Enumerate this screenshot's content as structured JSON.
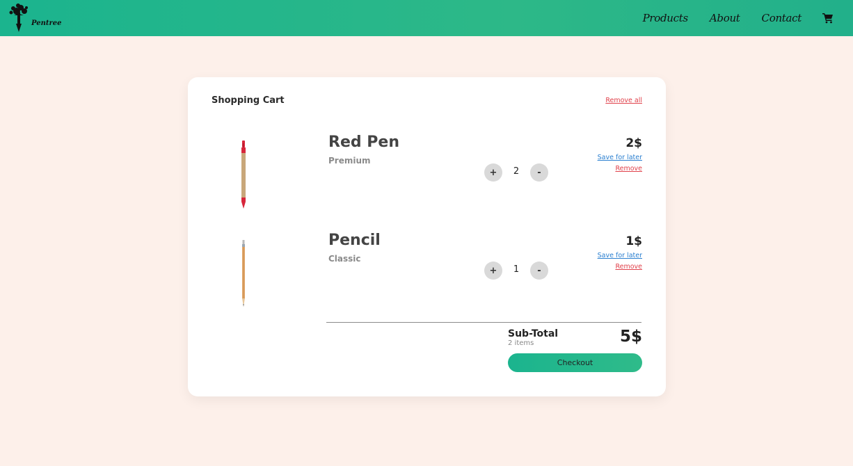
{
  "navbar": {
    "logo_text": "Pentree",
    "links": [
      "Products",
      "About",
      "Contact"
    ]
  },
  "cart": {
    "title": "Shopping Cart",
    "remove_all_label": "Remove all",
    "items": [
      {
        "name": "Red Pen",
        "variant": "Premium",
        "quantity": "2",
        "price": "2$",
        "plus_label": "+",
        "minus_label": "-",
        "save_label": "Save for later",
        "remove_label": "Remove",
        "color": "#d8263b"
      },
      {
        "name": "Pencil",
        "variant": "Classic",
        "quantity": "1",
        "price": "1$",
        "plus_label": "+",
        "minus_label": "-",
        "save_label": "Save for later",
        "remove_label": "Remove",
        "color": "#e3a86a"
      }
    ],
    "subtotal_label": "Sub-Total",
    "subtotal_count": "2 items",
    "subtotal_amount": "5$",
    "checkout_label": "Checkout"
  },
  "colors": {
    "accent": "#1bb48e",
    "background": "#fdf0ea",
    "danger": "#e0404a",
    "link": "#2a7fd0"
  }
}
